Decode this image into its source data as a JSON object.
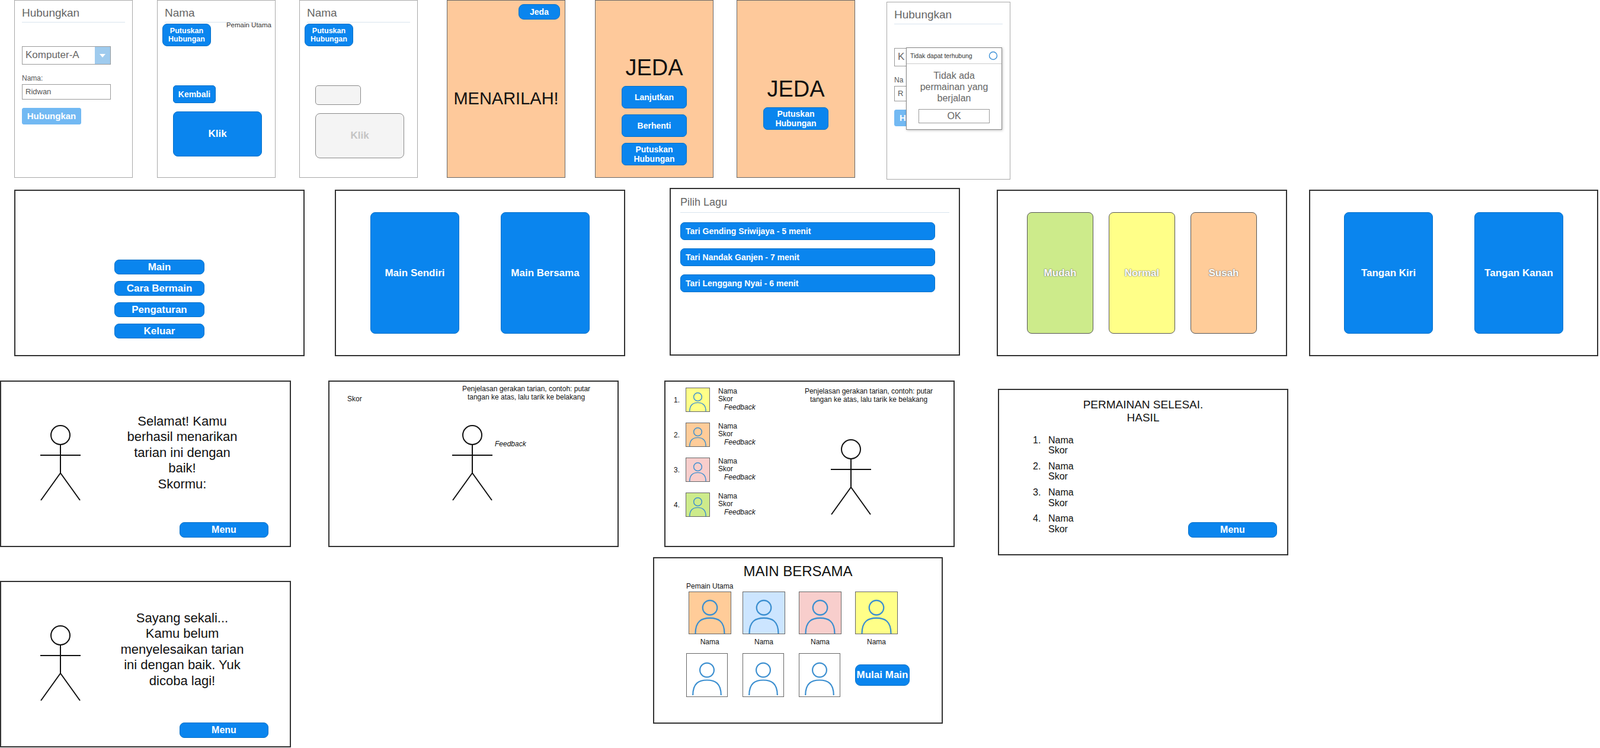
{
  "connect_screen": {
    "title": "Hubungkan",
    "device": "Komputer-A",
    "name_label": "Nama:",
    "name_value": "Ridwan",
    "button": {
      "label": "Hubungkan",
      "disabled": true
    }
  },
  "controller_screen": {
    "title": "Nama",
    "role": "Pemain Utama",
    "disconnect": {
      "label": "Putuskan Hubungan",
      "disabled": false
    },
    "back": {
      "label": "Kembali",
      "disabled": false
    },
    "tap": {
      "label": "Klik",
      "disabled": false
    }
  },
  "controller_disabled": {
    "title": "Nama",
    "disconnect": {
      "label": "Putuskan Hubungan",
      "disabled": false
    },
    "back": {
      "disabled": true
    },
    "tap": {
      "label": "Klik",
      "disabled": true
    }
  },
  "dance_screen": {
    "pause_button": "Jeda",
    "message": "MENARILAH!"
  },
  "pause_screen": {
    "title": "JEDA",
    "buttons": [
      "Lanjutkan",
      "Berhenti",
      "Putuskan Hubungan"
    ]
  },
  "pause_guest_screen": {
    "title": "JEDA",
    "buttons": [
      "Putuskan Hubungan"
    ]
  },
  "connect_error": {
    "title": "Hubungkan",
    "device_partial": "K",
    "name_label_partial": "Na",
    "name_value_partial": "R",
    "button_partial": "H",
    "dialog": {
      "title": "Tidak dapat terhubung",
      "message": "Tidak ada permainan yang berjalan",
      "button": "OK"
    }
  },
  "main_menu": {
    "items": [
      "Main",
      "Cara Bermain",
      "Pengaturan",
      "Keluar"
    ]
  },
  "mode_select": {
    "options": [
      "Main Sendiri",
      "Main Bersama"
    ]
  },
  "song_select": {
    "title": "Pilih Lagu",
    "songs": [
      "Tari Gending Sriwijaya - 5 menit",
      "Tari Nandak Ganjen - 7 menit",
      "Tari Lenggang Nyai - 6 menit"
    ]
  },
  "difficulty_select": {
    "options": [
      {
        "label": "Mudah",
        "color": "#cdeb8b"
      },
      {
        "label": "Normal",
        "color": "#ffff88"
      },
      {
        "label": "Susah",
        "color": "#ffcc99"
      }
    ]
  },
  "hand_select": {
    "options": [
      "Tangan Kiri",
      "Tangan Kanan"
    ]
  },
  "success_screen": {
    "message": "Selamat! Kamu berhasil menarikan tarian ini dengan baik!",
    "score_label": "Skormu:",
    "button": "Menu"
  },
  "solo_play": {
    "score_label": "Skor",
    "instruction": "Penjelasan gerakan tarian, contoh: putar tangan ke atas, lalu tarik ke belakang",
    "feedback": "Feedback"
  },
  "multi_play": {
    "players": [
      {
        "rank": "1.",
        "name": "Nama",
        "score": "Skor",
        "feedback": "Feedback",
        "color": "#ffff88"
      },
      {
        "rank": "2.",
        "name": "Nama",
        "score": "Skor",
        "feedback": "Feedback",
        "color": "#ffcc99"
      },
      {
        "rank": "3.",
        "name": "Nama",
        "score": "Skor",
        "feedback": "Feedback",
        "color": "#f8cecc"
      },
      {
        "rank": "4.",
        "name": "Nama",
        "score": "Skor",
        "feedback": "Feedback",
        "color": "#cdeb8b"
      }
    ],
    "instruction": "Penjelasan gerakan tarian, contoh: putar tangan ke atas, lalu tarik ke belakang"
  },
  "results": {
    "title": "PERMAINAN SELESAI.",
    "subtitle": "HASIL",
    "entries": [
      {
        "rank": "1.",
        "name": "Nama",
        "score": "Skor"
      },
      {
        "rank": "2.",
        "name": "Nama",
        "score": "Skor"
      },
      {
        "rank": "3.",
        "name": "Nama",
        "score": "Skor"
      },
      {
        "rank": "4.",
        "name": "Nama",
        "score": "Skor"
      }
    ],
    "button": "Menu"
  },
  "fail_screen": {
    "message": "Sayang sekali... Kamu belum menyelesaikan tarian ini dengan baik. Yuk dicoba lagi!",
    "button": "Menu"
  },
  "lobby": {
    "title": "MAIN BERSAMA",
    "host_label": "Pemain Utama",
    "players": [
      {
        "name": "Nama",
        "color": "#ffcc99",
        "host": true,
        "occupied": true
      },
      {
        "name": "Nama",
        "color": "#cce5ff",
        "host": false,
        "occupied": true
      },
      {
        "name": "Nama",
        "color": "#f8cecc",
        "host": false,
        "occupied": true
      },
      {
        "name": "Nama",
        "color": "#ffff88",
        "host": false,
        "occupied": true
      },
      {
        "name": "",
        "color": "#ffffff",
        "host": false,
        "occupied": false
      },
      {
        "name": "",
        "color": "#ffffff",
        "host": false,
        "occupied": false
      },
      {
        "name": "",
        "color": "#ffffff",
        "host": false,
        "occupied": false
      }
    ],
    "start_button": "Mulai Main"
  }
}
